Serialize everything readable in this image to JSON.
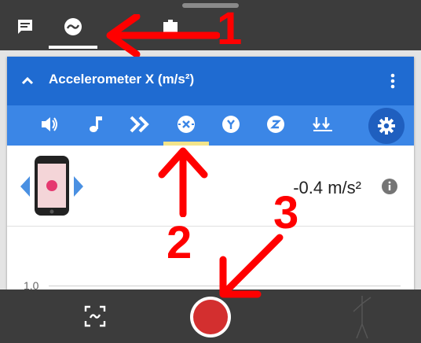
{
  "top_tabs": [
    {
      "name": "notes",
      "icon": "chat-icon"
    },
    {
      "name": "sensors",
      "icon": "sensor-wave-icon",
      "selected": true
    },
    {
      "name": "camera",
      "icon": "camera-icon"
    }
  ],
  "card": {
    "title": "Accelerometer X (m/s²)",
    "collapse_icon": "chevron-up-icon",
    "menu_icon": "more-vert-icon"
  },
  "sensor_toolbar": {
    "items": [
      {
        "name": "sound",
        "icon": "speaker-icon"
      },
      {
        "name": "music",
        "icon": "music-note-icon"
      },
      {
        "name": "chevrons",
        "icon": "double-chevron-icon"
      },
      {
        "name": "accel-x",
        "icon": "x-axis-icon",
        "selected": true
      },
      {
        "name": "accel-y",
        "icon": "y-axis-icon"
      },
      {
        "name": "accel-z",
        "icon": "z-axis-icon"
      },
      {
        "name": "linear-accel",
        "icon": "down-arrows-icon"
      }
    ],
    "settings_icon": "gear-icon"
  },
  "reading": {
    "value": "-0.4 m/s²",
    "info_icon": "info-icon"
  },
  "graph": {
    "y_tick_label": "1.0"
  },
  "bottom_bar": {
    "snapshot_icon": "snapshot-icon",
    "record_icon": "record-icon"
  },
  "annotations": {
    "label_1": "1",
    "label_2": "2",
    "label_3": "3",
    "color": "#ff0000"
  },
  "colors": {
    "header_blue": "#1f6bd1",
    "toolbar_blue": "#3b86e6",
    "dark_bar": "#3c3c3c",
    "record_red": "#d32f2f",
    "phone_dot": "#e53970"
  }
}
